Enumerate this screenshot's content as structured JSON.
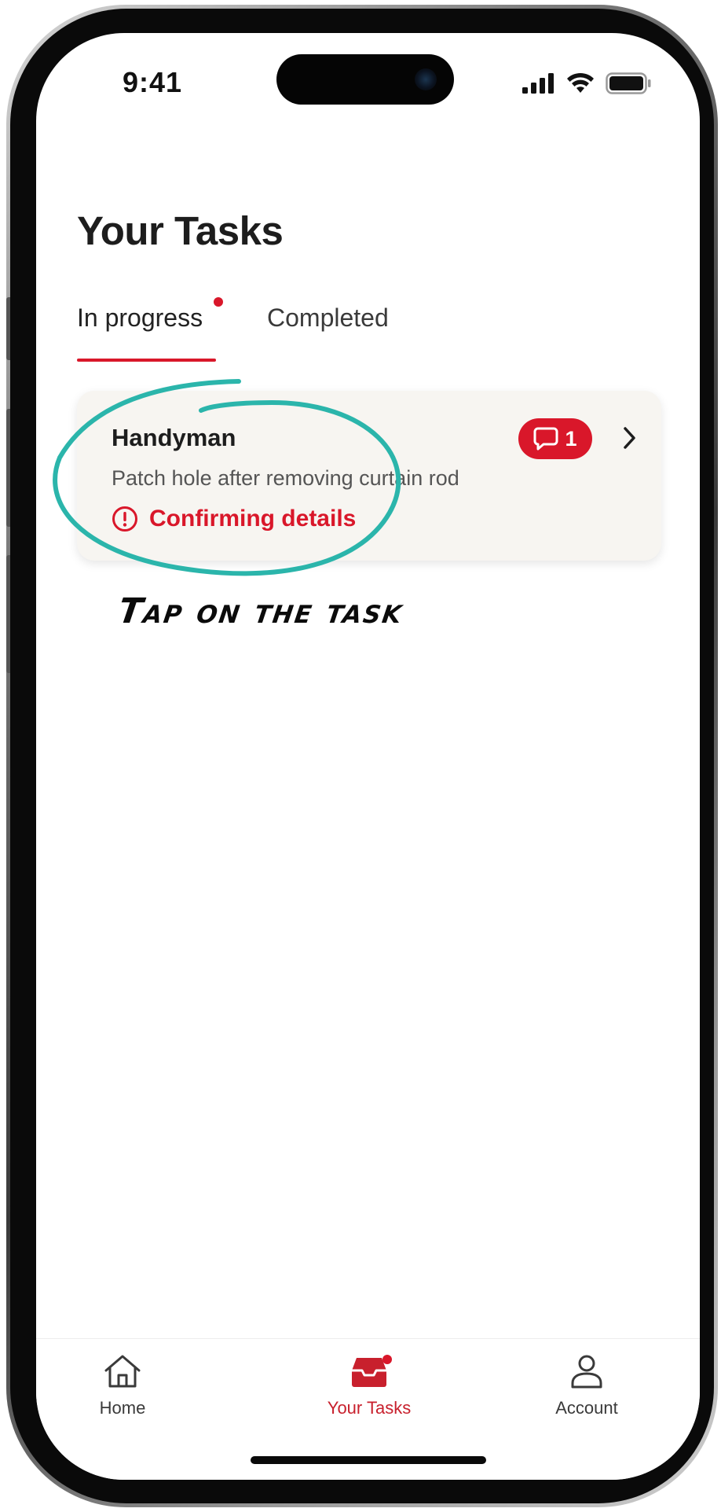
{
  "status_bar": {
    "time": "9:41"
  },
  "page": {
    "title": "Your Tasks"
  },
  "tabs": [
    {
      "label": "In progress",
      "active": true,
      "has_dot": true
    },
    {
      "label": "Completed",
      "active": false,
      "has_dot": false
    }
  ],
  "task": {
    "title": "Handyman",
    "description": "Patch hole after removing curtain rod",
    "status": "Confirming details",
    "message_count": "1",
    "status_icon": "alert-circle-icon",
    "message_icon": "chat-bubble-icon",
    "chevron_icon": "chevron-right-icon"
  },
  "annotation": {
    "text": "Tap on the task",
    "color": "#2bb5ab"
  },
  "bottom_nav": {
    "items": [
      {
        "label": "Home",
        "icon": "home-icon",
        "active": false
      },
      {
        "label": "Your Tasks",
        "icon": "inbox-icon",
        "active": true
      },
      {
        "label": "Account",
        "icon": "person-icon",
        "active": false
      }
    ]
  },
  "colors": {
    "accent": "#d9172a",
    "active_nav": "#c8202d",
    "card_bg": "#f7f5f1",
    "annotation": "#2bb5ab"
  }
}
